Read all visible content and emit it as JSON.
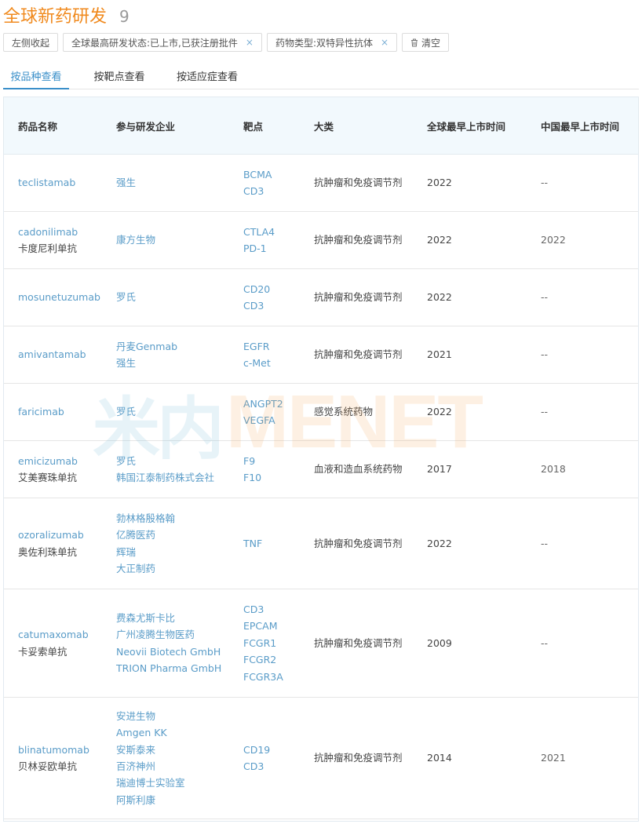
{
  "header": {
    "title": "全球新药研发",
    "count": "9"
  },
  "filters": {
    "collapse_label": "左侧收起",
    "chips": [
      {
        "label": "全球最高研发状态:已上市,已获注册批件",
        "close": "×"
      },
      {
        "label": "药物类型:双特异性抗体",
        "close": "×"
      }
    ],
    "clear_label": "清空"
  },
  "tabs": [
    {
      "label": "按品种查看",
      "active": true
    },
    {
      "label": "按靶点查看",
      "active": false
    },
    {
      "label": "按适应症查看",
      "active": false
    }
  ],
  "table": {
    "columns": [
      "药品名称",
      "参与研发企业",
      "靶点",
      "大类",
      "全球最早上市时间",
      "中国最早上市时间"
    ],
    "rows": [
      {
        "name_en": "teclistamab",
        "name_cn": "",
        "companies": [
          "强生"
        ],
        "targets": [
          "BCMA",
          "CD3"
        ],
        "category": "抗肿瘤和免疫调节剂",
        "global_year": "2022",
        "china_year": "--"
      },
      {
        "name_en": "cadonilimab",
        "name_cn": "卡度尼利单抗",
        "companies": [
          "康方生物"
        ],
        "targets": [
          "CTLA4",
          "PD-1"
        ],
        "category": "抗肿瘤和免疫调节剂",
        "global_year": "2022",
        "china_year": "2022"
      },
      {
        "name_en": "mosunetuzumab",
        "name_cn": "",
        "companies": [
          "罗氏"
        ],
        "targets": [
          "CD20",
          "CD3"
        ],
        "category": "抗肿瘤和免疫调节剂",
        "global_year": "2022",
        "china_year": "--"
      },
      {
        "name_en": "amivantamab",
        "name_cn": "",
        "companies": [
          "丹麦Genmab",
          "强生"
        ],
        "targets": [
          "EGFR",
          "c-Met"
        ],
        "category": "抗肿瘤和免疫调节剂",
        "global_year": "2021",
        "china_year": "--"
      },
      {
        "name_en": "faricimab",
        "name_cn": "",
        "companies": [
          "罗氏"
        ],
        "targets": [
          "ANGPT2",
          "VEGFA"
        ],
        "category": "感觉系统药物",
        "global_year": "2022",
        "china_year": "--"
      },
      {
        "name_en": "emicizumab",
        "name_cn": "艾美赛珠单抗",
        "companies": [
          "罗氏",
          "韩国江泰制药株式会社"
        ],
        "targets": [
          "F9",
          "F10"
        ],
        "category": "血液和造血系统药物",
        "global_year": "2017",
        "china_year": "2018"
      },
      {
        "name_en": "ozoralizumab",
        "name_cn": "奥佐利珠单抗",
        "companies": [
          "勃林格殷格翰",
          "亿腾医药",
          "辉瑞",
          "大正制药"
        ],
        "targets": [
          "TNF"
        ],
        "category": "抗肿瘤和免疫调节剂",
        "global_year": "2022",
        "china_year": "--"
      },
      {
        "name_en": "catumaxomab",
        "name_cn": "卡妥索单抗",
        "companies": [
          "费森尤斯卡比",
          "广州凌腾生物医药",
          "Neovii Biotech GmbH",
          "TRION Pharma GmbH"
        ],
        "targets": [
          "CD3",
          "EPCAM",
          "FCGR1",
          "FCGR2",
          "FCGR3A"
        ],
        "category": "抗肿瘤和免疫调节剂",
        "global_year": "2009",
        "china_year": "--"
      },
      {
        "name_en": "blinatumomab",
        "name_cn": "贝林妥欧单抗",
        "companies": [
          "安进生物",
          "Amgen KK",
          "安斯泰来",
          "百济神州",
          "瑞迪博士实验室",
          "阿斯利康"
        ],
        "targets": [
          "CD19",
          "CD3"
        ],
        "category": "抗肿瘤和免疫调节剂",
        "global_year": "2014",
        "china_year": "2021"
      }
    ]
  },
  "watermark": {
    "cn": "米内",
    "en": "MENET"
  }
}
